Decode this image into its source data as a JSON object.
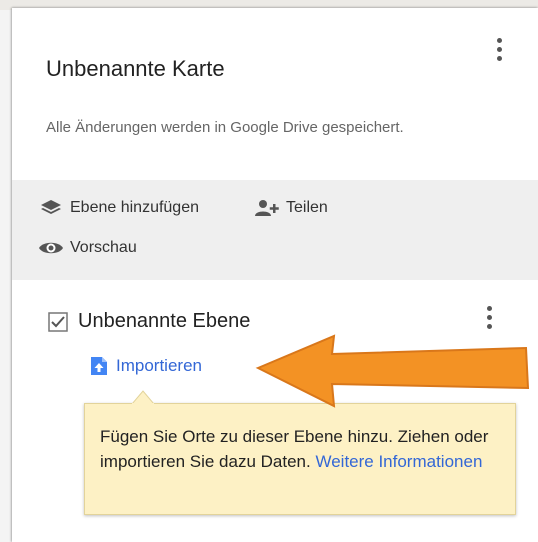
{
  "map_title": "Unbenannte Karte",
  "save_status": "Alle Änderungen werden in Google Drive gespeichert.",
  "actions": {
    "add_layer": "Ebene hinzufügen",
    "share": "Teilen",
    "preview": "Vorschau"
  },
  "layer": {
    "name": "Unbenannte Ebene",
    "checked": true,
    "import_label": "Importieren"
  },
  "tooltip": {
    "text": "Fügen Sie Orte zu dieser Ebene hinzu. Ziehen oder importieren Sie dazu Daten.",
    "link_label": "Weitere Informationen"
  },
  "icons": {
    "add_layer": "layers-icon",
    "share": "add-person-icon",
    "preview": "eye-icon",
    "checkbox": "checkmark-icon",
    "import": "file-upload-icon",
    "menu": "more-vert-icon",
    "annotation": "orange-arrow"
  },
  "colors": {
    "link": "#3367d6",
    "tooltip_bg": "#fdf1c5",
    "actions_bg": "#efefef",
    "annotation_arrow": "#f39224"
  }
}
